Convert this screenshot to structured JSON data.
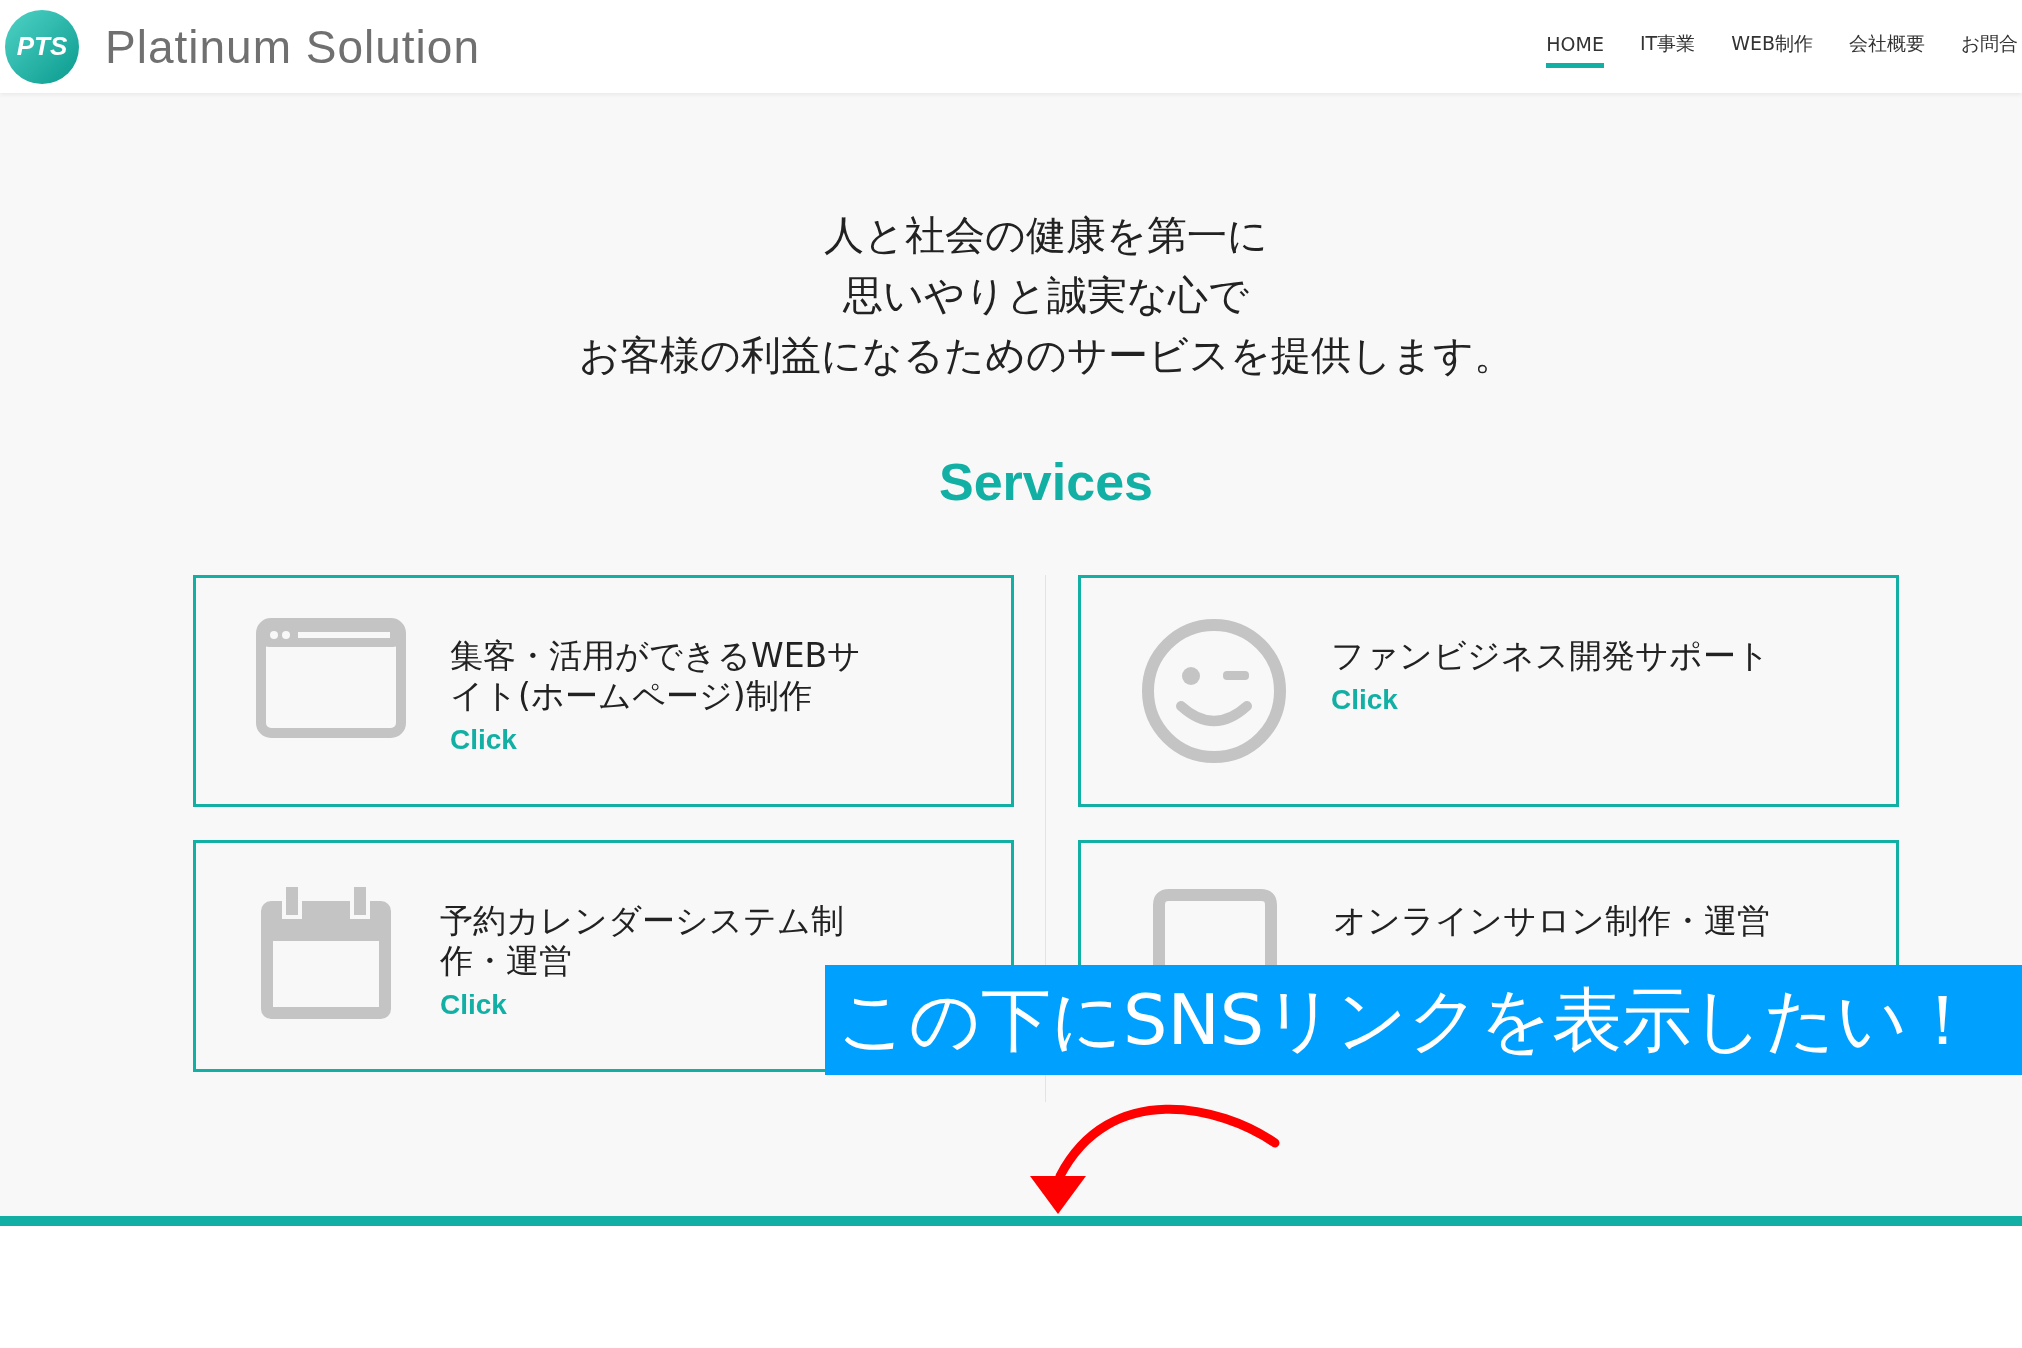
{
  "header": {
    "logo_mark": "PTS",
    "site_name": "Platinum Solution"
  },
  "nav": [
    {
      "label": "HOME",
      "selected": true
    },
    {
      "label": "IT事業",
      "selected": false
    },
    {
      "label": "WEB制作",
      "selected": false
    },
    {
      "label": "会社概要",
      "selected": false
    },
    {
      "label": "お問合",
      "selected": false
    }
  ],
  "tagline": [
    "人と社会の健康を第一に",
    "思いやりと誠実な心で",
    "お客様の利益になるためのサービスを提供します。"
  ],
  "services": {
    "heading": "Services",
    "cards": [
      {
        "kind": "browser",
        "title": "集客・活用ができるWEBサイト(ホームページ)制作",
        "link": "Click"
      },
      {
        "kind": "smile",
        "title": "ファンビジネス開発サポート",
        "link": "Click"
      },
      {
        "kind": "calendar",
        "title": "予約カレンダーシステム制作・運営",
        "link": "Click"
      },
      {
        "kind": "tablet",
        "title": "オンラインサロン制作・運営"
      }
    ]
  },
  "annotation": {
    "banner": "この下にSNSリンクを表示したい！"
  }
}
